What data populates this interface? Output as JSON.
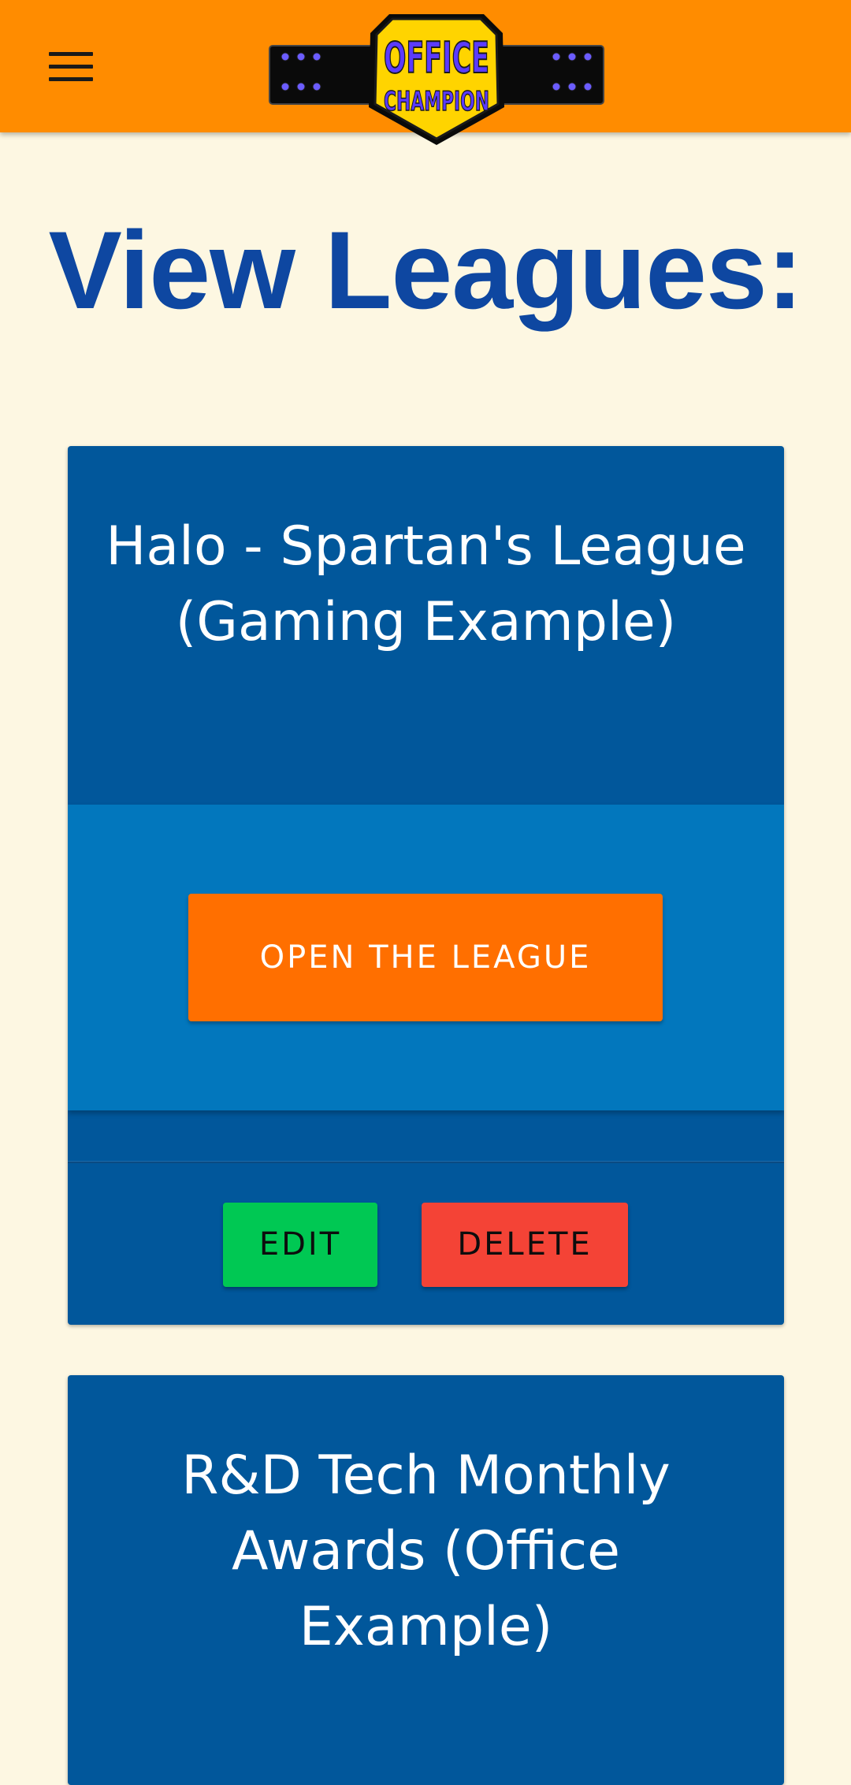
{
  "app_bar": {
    "menu_icon": "hamburger-menu-icon",
    "logo": {
      "line1": "OFFICE",
      "line2": "CHAMPION",
      "colors": {
        "belt": "#000000",
        "plate": "#ffd400",
        "letters": "#5b3bff",
        "studs": "#6b5cff"
      }
    },
    "background": "#ff8c00"
  },
  "page": {
    "title": "View Leagues:",
    "title_color": "#0e47a1",
    "background": "#fdf7e2"
  },
  "leagues": [
    {
      "title": "Halo - Spartan's League (Gaming Example)",
      "open_label": "OPEN THE LEAGUE",
      "edit_label": "EDIT",
      "delete_label": "DELETE"
    },
    {
      "title": "R&D Tech Monthly Awards (Office Example)"
    }
  ],
  "colors": {
    "card": "#01579b",
    "card_action_area": "#0277bd",
    "open_button": "#ff6f00",
    "edit_button": "#00c853",
    "delete_button": "#f44336"
  }
}
